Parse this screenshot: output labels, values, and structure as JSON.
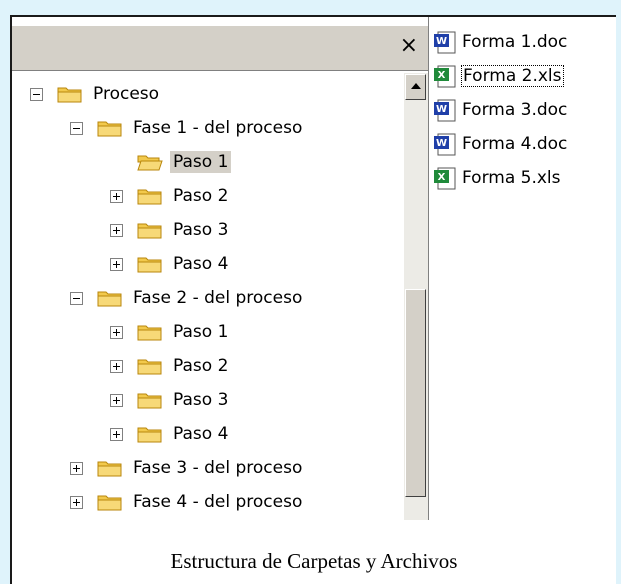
{
  "window": {
    "close_glyph": "×"
  },
  "tree": {
    "rows": [
      {
        "label": "Proceso",
        "expander": "minus"
      },
      {
        "label": "Fase 1 - del proceso",
        "expander": "minus"
      },
      {
        "label": "Paso 1",
        "expander": "none",
        "selected": true
      },
      {
        "label": "Paso 2",
        "expander": "plus"
      },
      {
        "label": "Paso 3",
        "expander": "plus"
      },
      {
        "label": "Paso 4",
        "expander": "plus"
      },
      {
        "label": "Fase 2 - del proceso",
        "expander": "minus"
      },
      {
        "label": "Paso 1",
        "expander": "plus"
      },
      {
        "label": "Paso 2",
        "expander": "plus"
      },
      {
        "label": "Paso 3",
        "expander": "plus"
      },
      {
        "label": "Paso 4",
        "expander": "plus"
      },
      {
        "label": "Fase 3 - del proceso",
        "expander": "plus"
      },
      {
        "label": "Fase 4 - del proceso",
        "expander": "plus"
      }
    ]
  },
  "files": [
    {
      "name": "Forma 1.doc",
      "icon": "word-doc-icon"
    },
    {
      "name": "Forma 2.xls",
      "icon": "excel-xls-icon",
      "focused": true
    },
    {
      "name": "Forma 3.doc",
      "icon": "word-doc-icon"
    },
    {
      "name": "Forma 4.doc",
      "icon": "word-doc-icon"
    },
    {
      "name": "Forma 5.xls",
      "icon": "excel-xls-icon"
    }
  ],
  "caption": "Estructura de Carpetas y Archivos",
  "colors": {
    "background": "#dff3fb",
    "pane_header": "#d4d0c8",
    "folder": "#f2c94c",
    "word_icon": "#1f3fa8",
    "excel_icon": "#1f8a3a"
  }
}
